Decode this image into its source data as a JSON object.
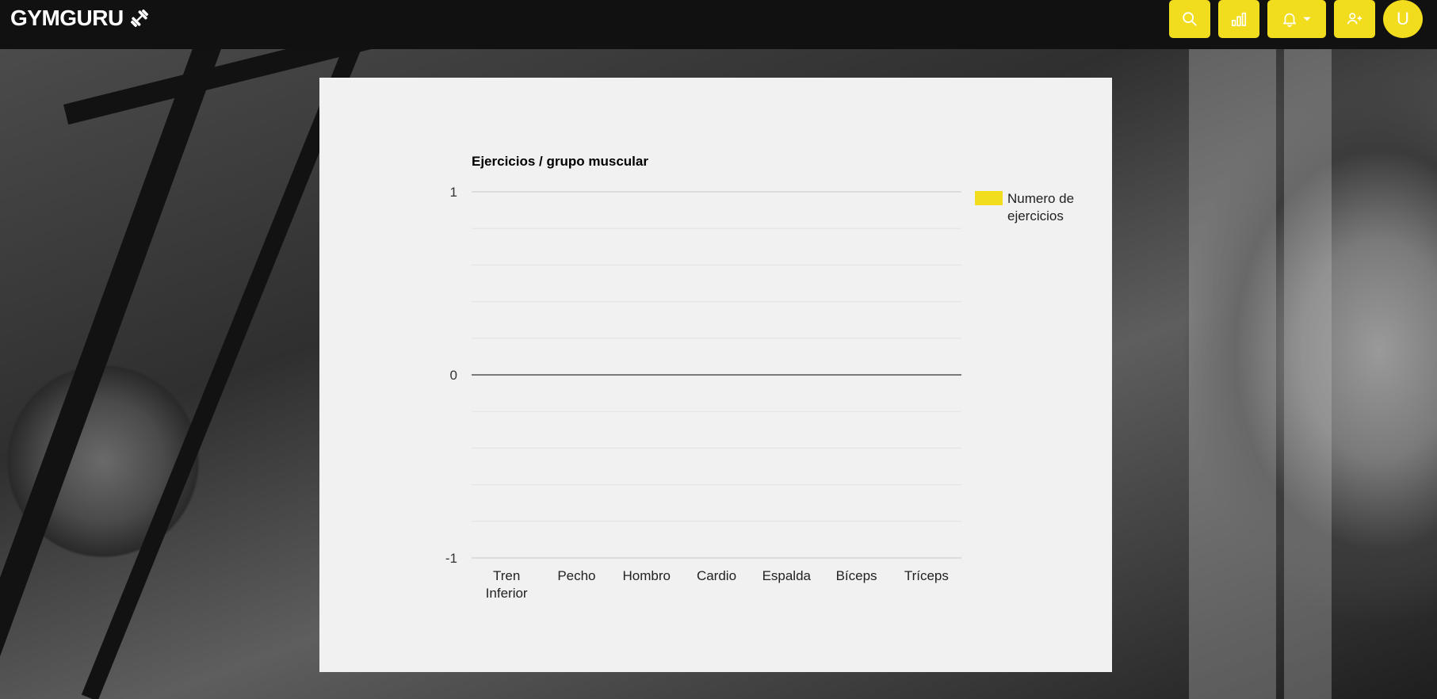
{
  "brand": {
    "name": "GYMGURU",
    "icon": "dumbbell-icon"
  },
  "toolbar": {
    "buttons": [
      {
        "name": "search-button",
        "icon": "search-icon"
      },
      {
        "name": "stats-button",
        "icon": "bar-chart-icon"
      },
      {
        "name": "notifications-button",
        "icon": "bell-icon",
        "has_dropdown": true
      },
      {
        "name": "add-user-button",
        "icon": "user-plus-icon"
      }
    ],
    "avatar_initial": "U"
  },
  "colors": {
    "accent": "#f2dc1e",
    "topbar": "#111111",
    "card": "#f1f1f1"
  },
  "chart_data": {
    "type": "bar",
    "title": "Ejercicios / grupo muscular",
    "categories": [
      "Tren Inferior",
      "Pecho",
      "Hombro",
      "Cardio",
      "Espalda",
      "Bíceps",
      "Tríceps"
    ],
    "series": [
      {
        "name": "Numero de ejercicios",
        "values": [
          0,
          0,
          0,
          0,
          0,
          0,
          0
        ],
        "color": "#f2dc1e"
      }
    ],
    "ylim": [
      -1,
      1
    ],
    "yticks": [
      "1",
      "0",
      "-1"
    ],
    "grid": true,
    "legend_position": "right"
  }
}
